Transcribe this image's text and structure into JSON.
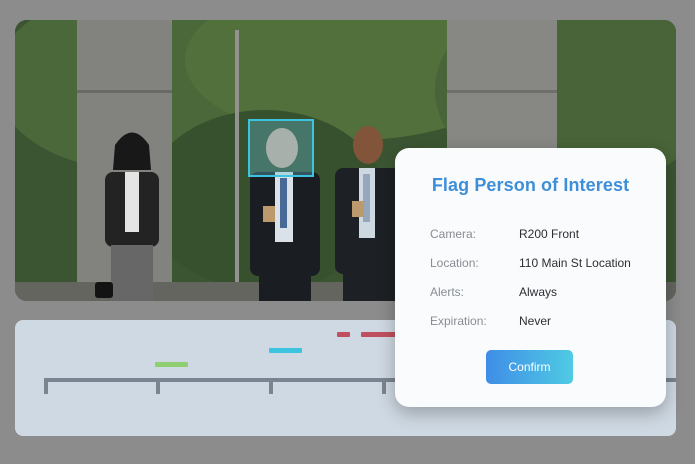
{
  "modal": {
    "title": "Flag Person of Interest",
    "fields": [
      {
        "label": "Camera:",
        "value": "R200 Front"
      },
      {
        "label": "Location:",
        "value": "110 Main St Location"
      },
      {
        "label": "Alerts:",
        "value": "Always"
      },
      {
        "label": "Expiration:",
        "value": "Never"
      }
    ],
    "confirm_label": "Confirm"
  },
  "colors": {
    "title": "#3d8fd9",
    "face_box": "#3cc4de",
    "event_green": "#8fcf72",
    "event_cyan": "#3cc4de",
    "event_red": "#c0505f",
    "timeline_bg": "#cfd9e3",
    "overlay": "#8c8c8c"
  }
}
